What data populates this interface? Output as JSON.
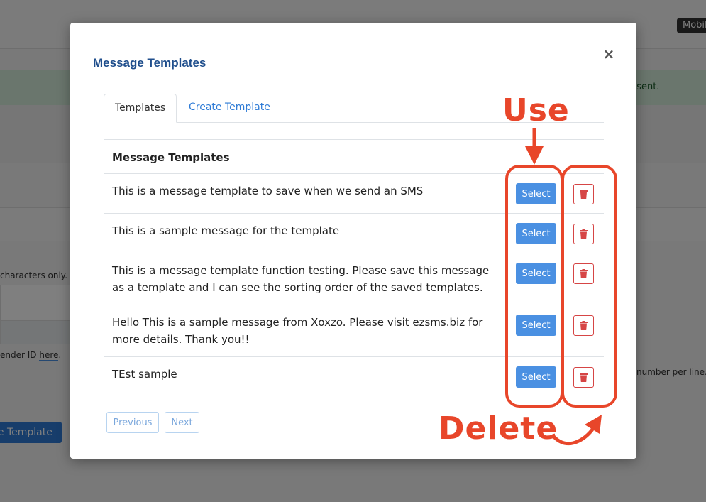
{
  "background": {
    "badge": "Mobil",
    "alert_text": "re sent.",
    "hint": " characters only.",
    "sender_prefix": "ender ID ",
    "sender_link": "here",
    "sender_suffix": ".",
    "right_hint": "number per line.",
    "button_label": "ge Template"
  },
  "modal": {
    "title": "Message Templates",
    "close_label": "×",
    "tabs": [
      {
        "label": "Templates",
        "active": true
      },
      {
        "label": "Create Template",
        "active": false
      }
    ],
    "table_header": "Message Templates",
    "rows": [
      {
        "text": "This is a message template to save when we send an SMS",
        "select_label": "Select"
      },
      {
        "text": "This is a sample message for the template",
        "select_label": "Select"
      },
      {
        "text": "This is a message template function testing. Please save this message as a template and I can see the sorting order of the saved templates.",
        "select_label": "Select"
      },
      {
        "text": "Hello This is a sample message from Xoxzo. Please visit ezsms.biz for more details. Thank you!!",
        "select_label": "Select"
      },
      {
        "text": "TEst sample",
        "select_label": "Select"
      }
    ],
    "pagination": {
      "previous": "Previous",
      "next": "Next"
    }
  },
  "annotations": {
    "use_label": "Use",
    "delete_label": "Delete",
    "color": "#e8462a"
  },
  "colors": {
    "primary": "#4a90e2",
    "danger": "#d64545",
    "title": "#1f4e8c"
  }
}
